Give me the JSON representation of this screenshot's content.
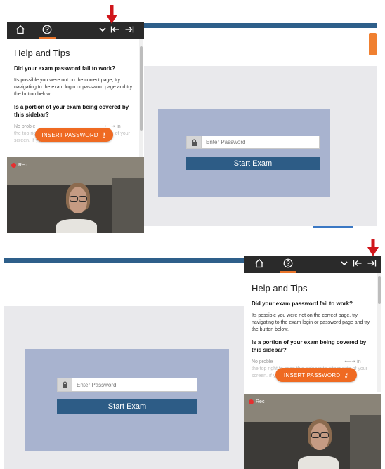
{
  "sidebar": {
    "title": "Help and Tips",
    "q1": "Did your exam password fail to work?",
    "p1": "Its possible you were not on the correct page, try navigating to the exam login or password page and try the button below.",
    "q2": "Is a portion of your exam being covered by this sidebar?",
    "p2_start": "No proble",
    "p2_right": "in",
    "p2_rest": "the top right to snap this sidebar to either side of your screen. If you would like to reduce the",
    "header_icons": [
      "home-icon",
      "help-circle-icon",
      "chevron-down-icon",
      "collapse-left-icon",
      "collapse-right-icon"
    ],
    "insert_button": "INSERT PASSWORD",
    "rec_label": "Rec"
  },
  "exam": {
    "password_placeholder": "Enter Password",
    "start_button": "Start Exam"
  },
  "colors": {
    "accent": "#ef6a22",
    "header": "#2a2a2a",
    "exam_blue": "#2d5c86",
    "card": "#a8b3cf",
    "arrow": "#d0161b"
  }
}
